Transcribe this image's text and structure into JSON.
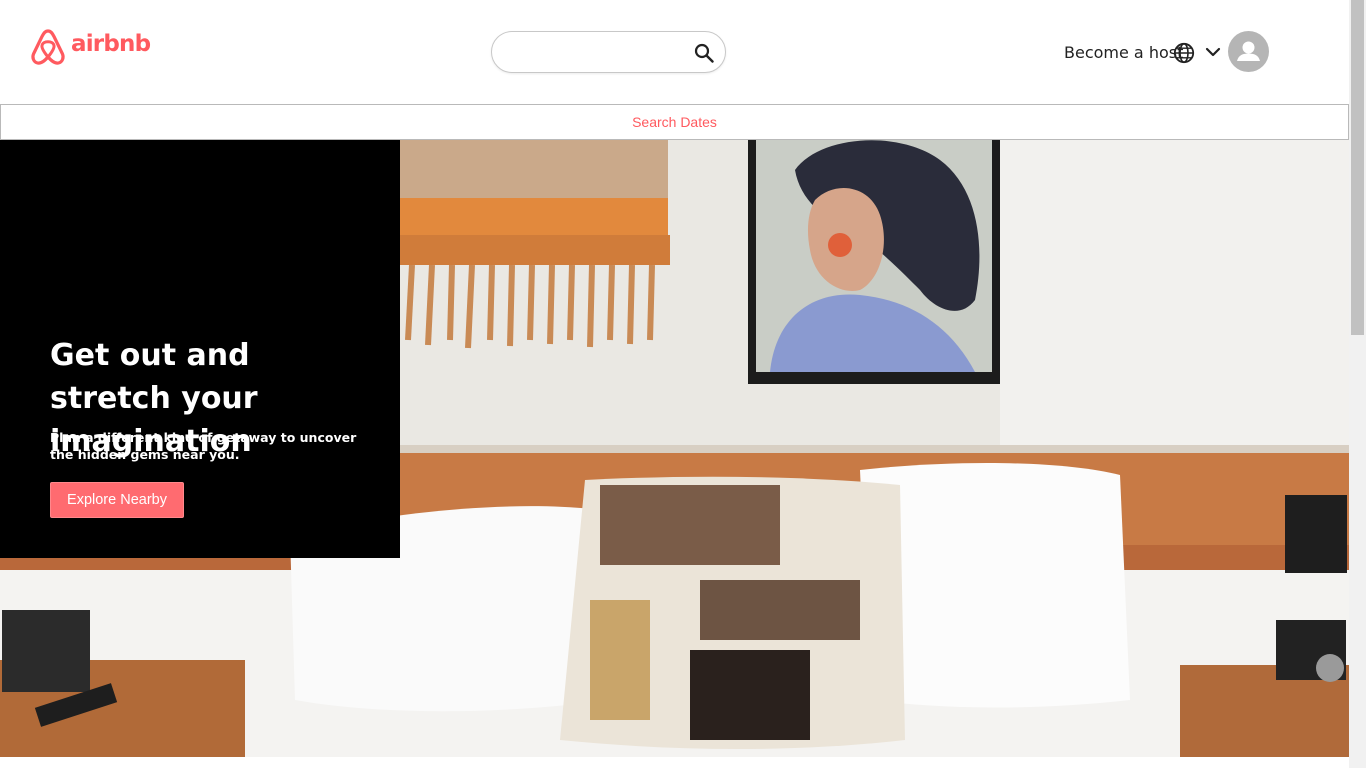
{
  "brand": {
    "name": "airbnb",
    "color": "#ff5a5f"
  },
  "header": {
    "search": {
      "value": "",
      "placeholder": "",
      "icon": "search-icon"
    },
    "host_link": "Become a host",
    "globe_icon": "globe-icon",
    "menu_icon": "chevron-down-icon",
    "avatar_icon": "user-avatar-icon"
  },
  "dates_bar": {
    "label": "Search Dates",
    "color": "#ff5a5f"
  },
  "hero": {
    "title": "Get out and stretch your imagination",
    "subtitle": "Plan a different kind of getaway to uncover the hidden gems near you.",
    "cta_label": "Explore Nearby",
    "cta_color": "#ff6b70",
    "card_color": "#000000",
    "image": "bedroom-interior-photo"
  }
}
